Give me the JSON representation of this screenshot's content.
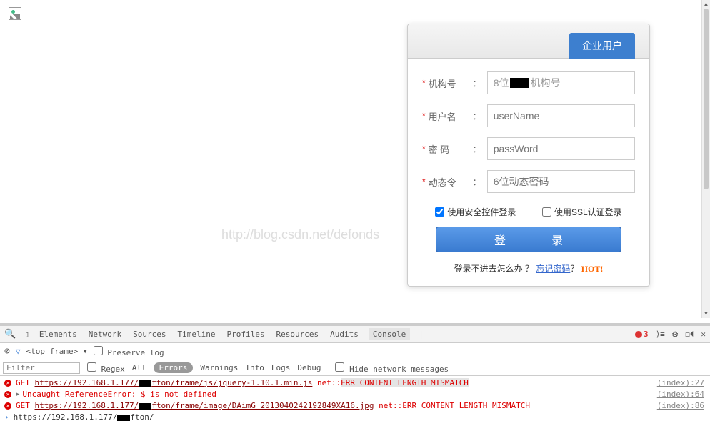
{
  "watermark": "http://blog.csdn.net/defonds",
  "login": {
    "tab_active": "企业用户",
    "fields": {
      "org": {
        "label": "机构号",
        "placeholder_prefix": "8位",
        "placeholder_suffix": "机构号"
      },
      "user": {
        "label": "用户名",
        "placeholder": "userName"
      },
      "pass": {
        "label": "密  码",
        "placeholder": "passWord"
      },
      "dyn": {
        "label": "动态令",
        "placeholder": "6位动态密码"
      }
    },
    "check_secure": "使用安全控件登录",
    "check_ssl": "使用SSL认证登录",
    "submit": "登　录",
    "help_q": "登录不进去怎么办 ？",
    "help_link": "忘记密码",
    "hot": "HOT!"
  },
  "devtools": {
    "tabs": [
      "Elements",
      "Network",
      "Sources",
      "Timeline",
      "Profiles",
      "Resources",
      "Audits",
      "Console"
    ],
    "active_tab": "Console",
    "error_count": "3",
    "frame_selector": "<top frame>",
    "preserve_log": "Preserve log",
    "filter_placeholder": "Filter",
    "regex": "Regex",
    "levels": [
      "All",
      "Errors",
      "Warnings",
      "Info",
      "Logs",
      "Debug"
    ],
    "active_level": "Errors",
    "hide_net": "Hide network messages",
    "rows": [
      {
        "type": "net-error",
        "method": "GET",
        "url_prefix": "https://192.168.1.177/",
        "url_suffix": "fton/frame/js/jquery-1.10.1.min.js",
        "err_prefix": "net::",
        "err_code": "ERR_CONTENT_LENGTH_MISMATCH",
        "source": "(index):27"
      },
      {
        "type": "js-error",
        "text": "Uncaught ReferenceError: $ is not defined",
        "source": "(index):64"
      },
      {
        "type": "net-error",
        "method": "GET",
        "url_prefix": "https://192.168.1.177/",
        "url_suffix": "fton/frame/image/DAimG_2013040242192849XA16.jpg",
        "err_prefix": "net::",
        "err_code": "ERR_CONTENT_LENGTH_MISMATCH",
        "source": "(index):86"
      },
      {
        "type": "prompt",
        "text_prefix": "https://192.168.1.177/",
        "text_suffix": "fton/"
      }
    ]
  }
}
